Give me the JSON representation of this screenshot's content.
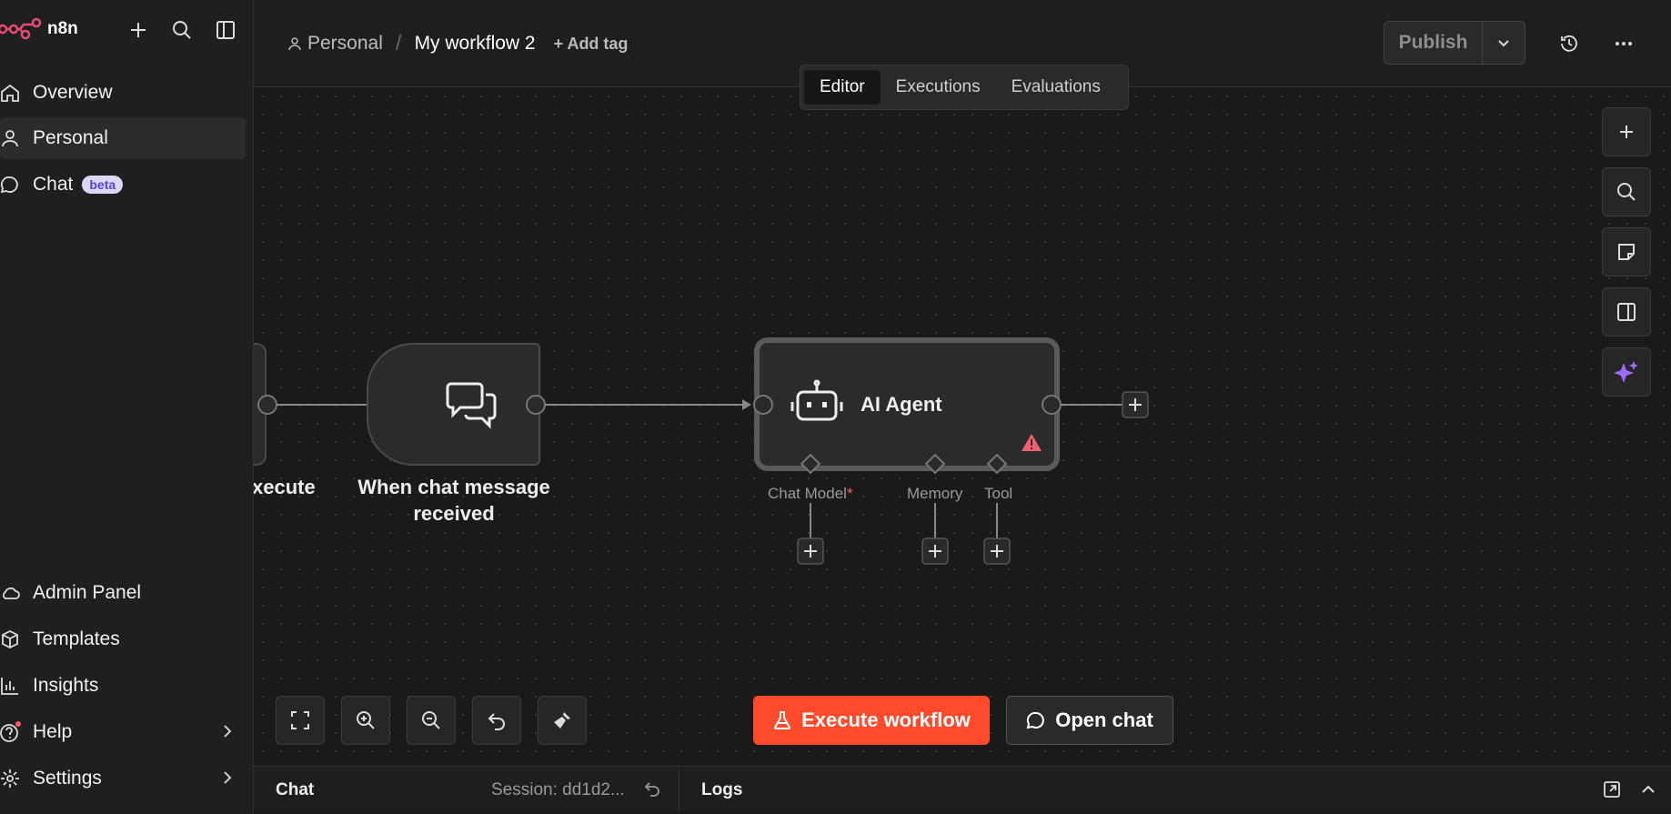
{
  "brand": {
    "name": "n8n"
  },
  "sidebar": {
    "top_items": [
      {
        "label": "Overview",
        "icon": "home-icon"
      },
      {
        "label": "Personal",
        "icon": "user-icon",
        "active": true
      },
      {
        "label": "Chat",
        "icon": "chat-icon",
        "badge": "beta"
      }
    ],
    "bottom_items": [
      {
        "label": "Admin Panel",
        "icon": "cloud-icon"
      },
      {
        "label": "Templates",
        "icon": "box-icon"
      },
      {
        "label": "Insights",
        "icon": "bar-chart-icon"
      },
      {
        "label": "Help",
        "icon": "help-icon"
      },
      {
        "label": "Settings",
        "icon": "gear-icon"
      }
    ]
  },
  "header": {
    "breadcrumb_project": "Personal",
    "breadcrumb_sep": "/",
    "workflow_name": "My workflow 2",
    "add_tag": "+ Add tag",
    "publish_label": "Publish"
  },
  "tabs": [
    "Editor",
    "Executions",
    "Evaluations"
  ],
  "active_tab": "Editor",
  "canvas": {
    "partial_node_label": "xecute",
    "trigger_node_label_line1": "When chat message",
    "trigger_node_label_line2": "received",
    "agent_node_label": "AI Agent",
    "handles": {
      "chat_model": "Chat Model",
      "required_mark": "*",
      "memory": "Memory",
      "tool": "Tool"
    }
  },
  "actions": {
    "execute_workflow": "Execute workflow",
    "open_chat": "Open chat"
  },
  "bottom_bar": {
    "chat": "Chat",
    "session": "Session: dd1d2...",
    "logs": "Logs"
  },
  "colors": {
    "accent_execute": "#ff4b2b",
    "brand": "#ea4b71",
    "ai_sparkle": "#9c6bff",
    "warning": "#f06070"
  }
}
